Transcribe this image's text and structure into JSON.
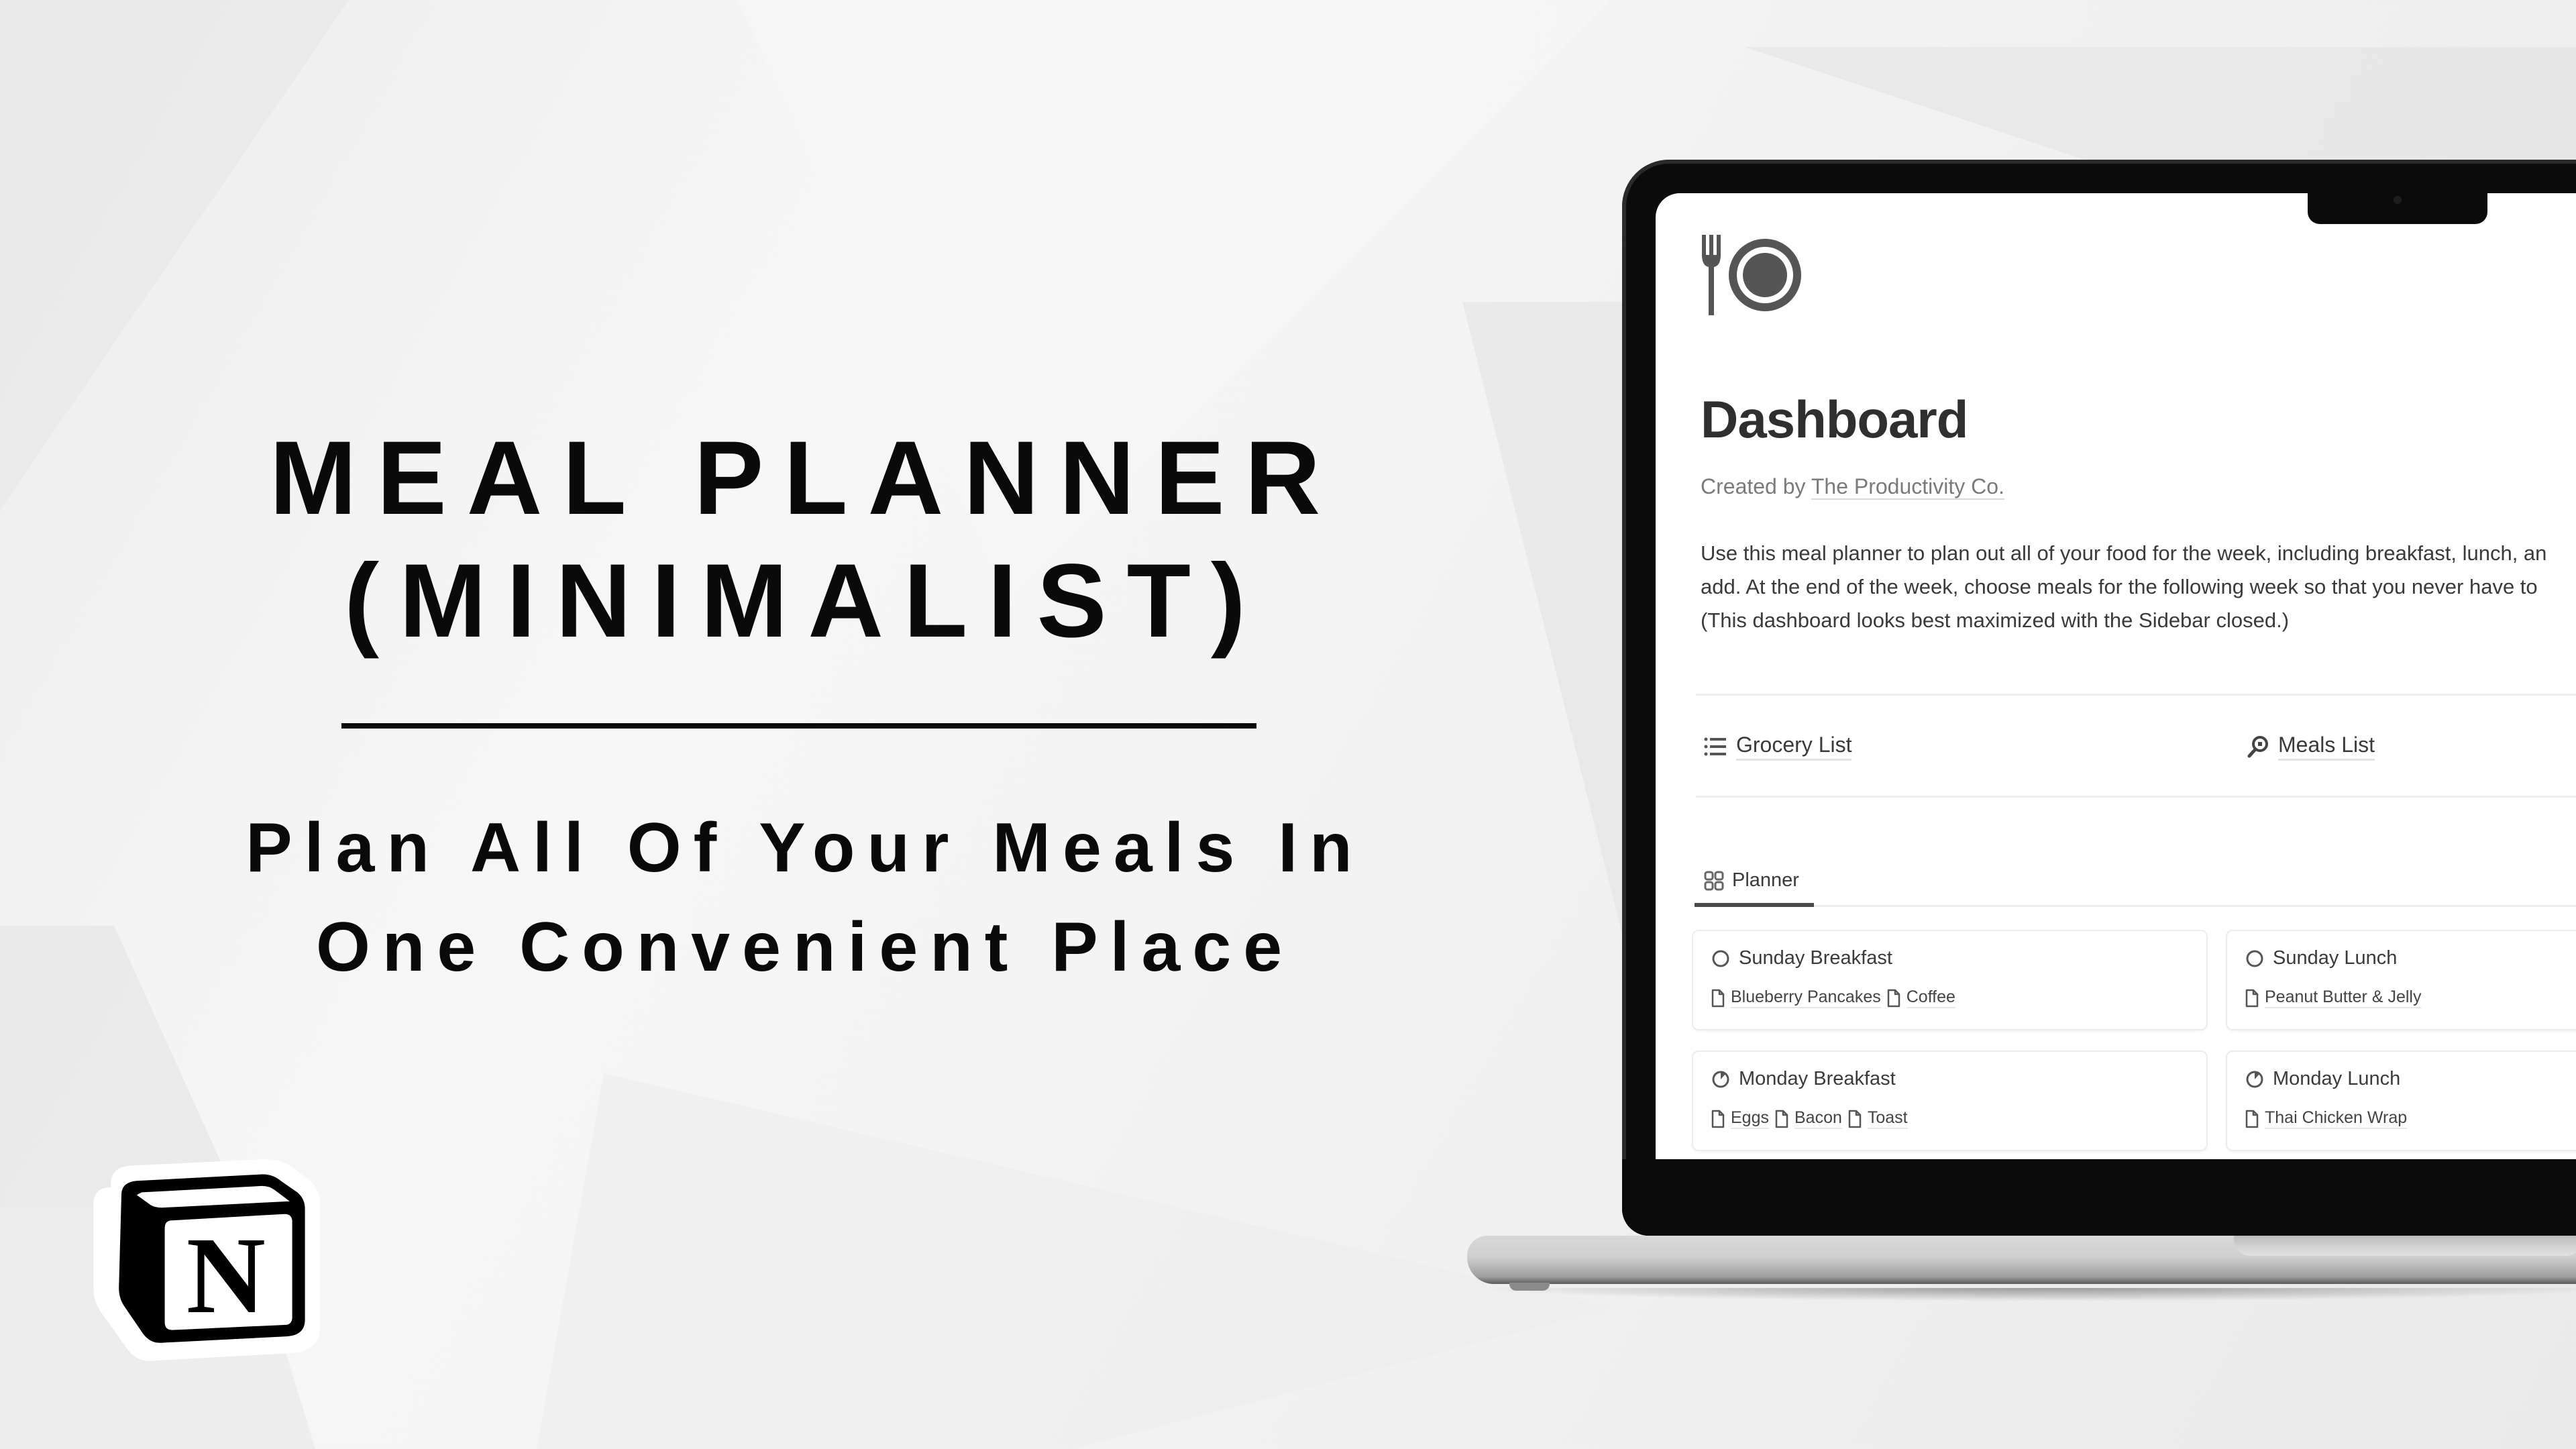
{
  "hero": {
    "title_line1": "MEAL PLANNER",
    "title_line2": "(MINIMALIST)",
    "subtitle_line1": "Plan All Of Your Meals In",
    "subtitle_line2": "One Convenient Place",
    "brand_logo": "notion-logo-icon"
  },
  "notion_page": {
    "icon": "fork-and-plate-icon",
    "title": "Dashboard",
    "byline_prefix": "Created by ",
    "byline_link": "The Productivity Co.",
    "description_lines": [
      "Use this meal planner to plan out all of your food for the week, including breakfast, lunch, an",
      "add. At the end of the week, choose meals for the following week so that you never have to",
      "(This dashboard looks best maximized with the Sidebar closed.)"
    ],
    "links": [
      {
        "label": "Grocery List",
        "icon": "bulleted-list-icon"
      },
      {
        "label": "Meals List",
        "icon": "search-doc-icon"
      }
    ],
    "view_tab": {
      "label": "Planner",
      "icon": "gallery-grid-icon"
    },
    "cards": [
      {
        "title": "Sunday Breakfast",
        "status_icon": "circle-empty-icon",
        "items": [
          "Blueberry Pancakes",
          "Coffee"
        ]
      },
      {
        "title": "Sunday Lunch",
        "status_icon": "circle-empty-icon",
        "items": [
          "Peanut Butter & Jelly"
        ]
      },
      {
        "title": "Monday Breakfast",
        "status_icon": "circle-in-progress-icon",
        "items": [
          "Eggs",
          "Bacon",
          "Toast"
        ]
      },
      {
        "title": "Monday Lunch",
        "status_icon": "circle-in-progress-icon",
        "items": [
          "Thai Chicken Wrap"
        ]
      }
    ]
  },
  "colors": {
    "text_primary": "#0a0a0a",
    "notion_text": "#37352f",
    "muted": "#7a7a7a"
  }
}
